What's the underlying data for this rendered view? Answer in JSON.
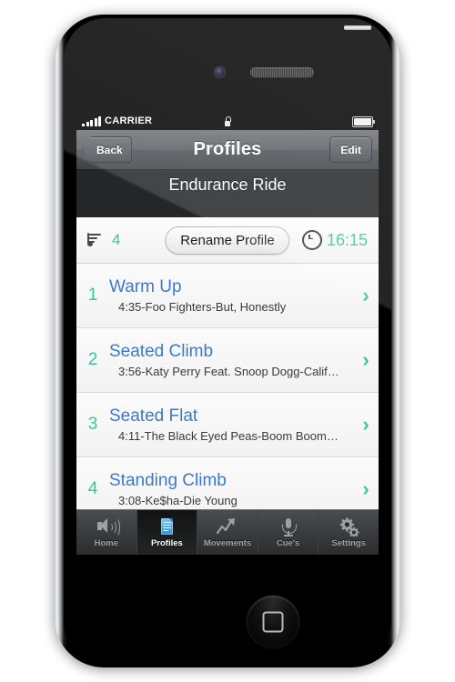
{
  "statusbar": {
    "signal_icon": "signal-bars-icon",
    "carrier": "CARRIER",
    "lock_icon": "lock-icon",
    "battery_icon": "battery-icon"
  },
  "navbar": {
    "back_label": "Back",
    "title": "Profiles",
    "edit_label": "Edit"
  },
  "subheader": {
    "profile_name": "Endurance Ride",
    "handle_icon": "drag-handle-icon"
  },
  "toolbar": {
    "playlist_icon": "playlist-music-note-icon",
    "track_count": "4",
    "rename_label": "Rename Profile",
    "clock_icon": "clock-icon",
    "total_time": "16:15"
  },
  "list": {
    "rows": [
      {
        "num": "1",
        "title": "Warm Up",
        "subtitle": "4:35-Foo Fighters-But, Honestly",
        "chevron": "›"
      },
      {
        "num": "2",
        "title": "Seated Climb",
        "subtitle": "3:56-Katy Perry Feat. Snoop Dogg-Calif…",
        "chevron": "›"
      },
      {
        "num": "3",
        "title": "Seated Flat",
        "subtitle": "4:11-The Black Eyed Peas-Boom Boom…",
        "chevron": "›"
      },
      {
        "num": "4",
        "title": "Standing Climb",
        "subtitle": "3:08-Ke$ha-Die Young",
        "chevron": "›"
      }
    ]
  },
  "tabbar": {
    "tabs": [
      {
        "label": "Home",
        "icon": "speaker-icon",
        "active": false
      },
      {
        "label": "Profiles",
        "icon": "document-icon",
        "active": true
      },
      {
        "label": "Movements",
        "icon": "chart-trend-icon",
        "active": false
      },
      {
        "label": "Cue's",
        "icon": "microphone-icon",
        "active": false
      },
      {
        "label": "Settings",
        "icon": "gears-icon",
        "active": false
      }
    ]
  },
  "device": {
    "camera_icon": "front-camera-icon",
    "earpiece_icon": "earpiece-speaker-icon",
    "home_button_icon": "home-button-icon"
  },
  "colors": {
    "accent_green": "#3cc6a0",
    "title_blue": "#3d7ac6",
    "tab_active_blue": "#2f93d6"
  }
}
